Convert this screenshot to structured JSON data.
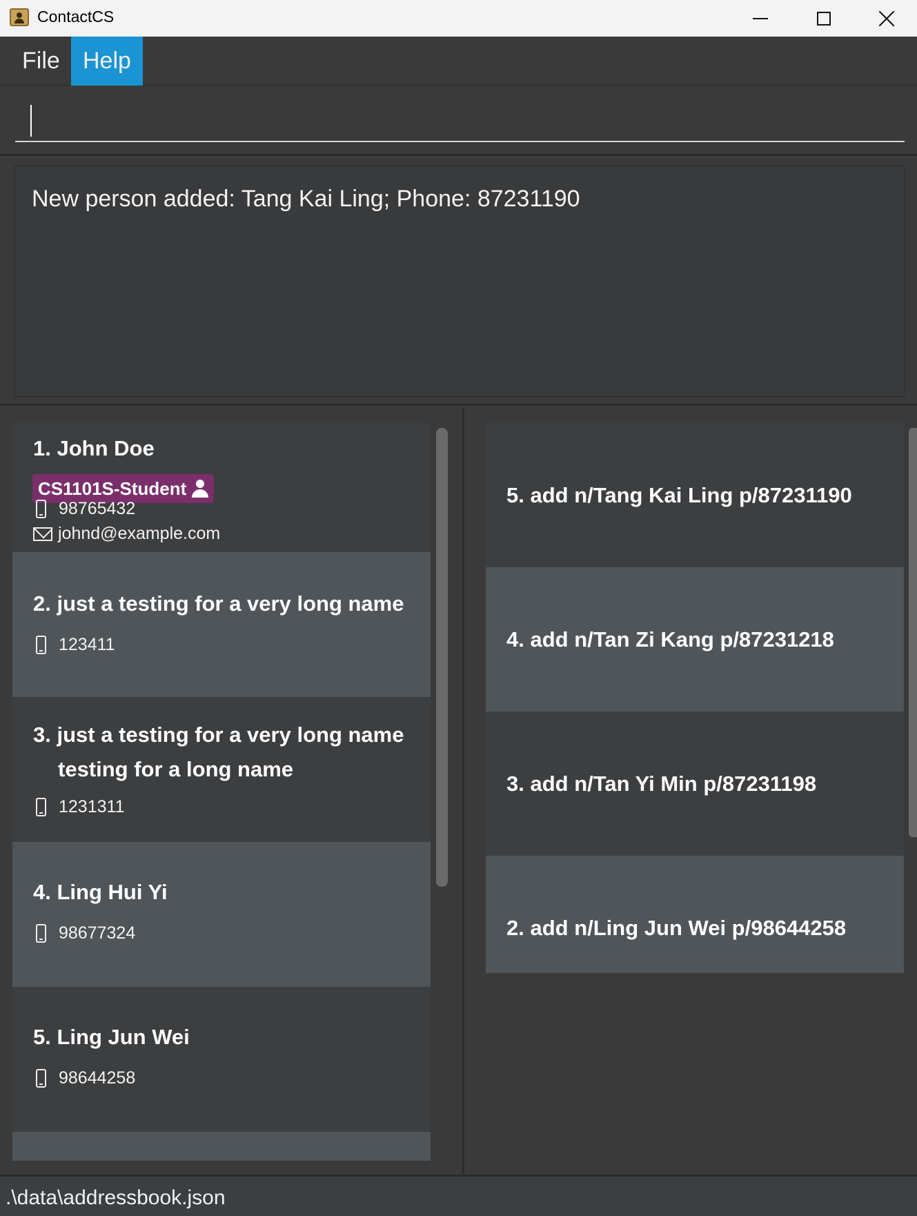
{
  "window": {
    "title": "ContactCS"
  },
  "menu": {
    "file": "File",
    "help": "Help"
  },
  "command": {
    "value": ""
  },
  "result": {
    "text": "New person added: Tang Kai Ling; Phone: 87231190"
  },
  "persons": [
    {
      "name": "1. John Doe",
      "tag": "CS1101S-Student",
      "phone": "98765432",
      "email": "johnd@example.com"
    },
    {
      "name": "2. just a testing for a very long name",
      "phone": "123411"
    },
    {
      "name_line1": "3. just a testing for a very long name",
      "name_line2": "testing for a long name",
      "phone": "1231311"
    },
    {
      "name": "4. Ling Hui Yi",
      "phone": "98677324"
    },
    {
      "name": "5. Ling Jun Wei",
      "phone": "98644258"
    }
  ],
  "history": [
    "5. add n/Tang Kai Ling p/87231190",
    "4. add n/Tan Zi Kang p/87231218",
    "3. add n/Tan Yi Min p/87231198",
    "2. add n/Ling Jun Wei p/98644258"
  ],
  "status": {
    "path": ".\\data\\addressbook.json"
  },
  "icons": {
    "app": "contacts-book-icon",
    "phone": "phone-icon",
    "email": "envelope-icon",
    "tag": "student-icon"
  }
}
